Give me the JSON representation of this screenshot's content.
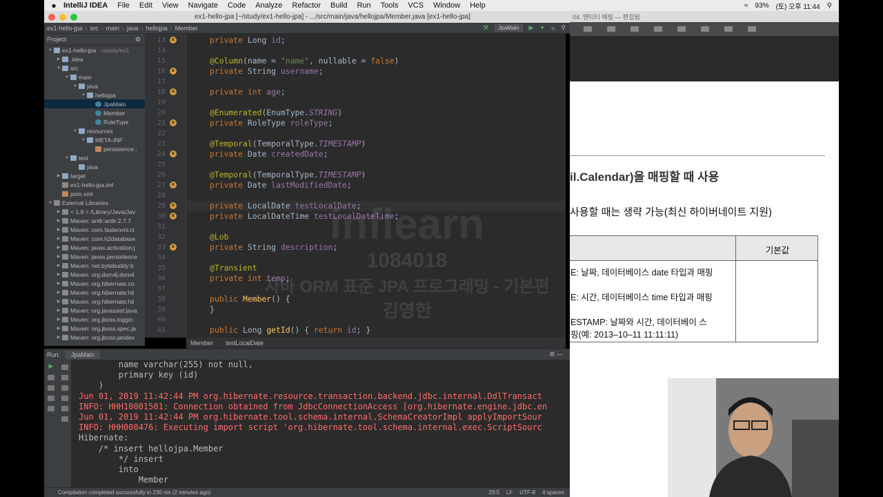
{
  "menubar": {
    "app_name": "IntelliJ IDEA",
    "items": [
      "File",
      "Edit",
      "View",
      "Navigate",
      "Code",
      "Analyze",
      "Refactor",
      "Build",
      "Run",
      "Tools",
      "VCS",
      "Window",
      "Help"
    ],
    "battery": "93%",
    "clock": "(토) 오후 11:44"
  },
  "window": {
    "title": "ex1-hello-jpa [~/study/ex1-hello-jpa] - .../src/main/java/hellojpa/Member.java [ex1-hello-jpa]"
  },
  "nav": {
    "crumbs": [
      "ex1-hello-jpa",
      "src",
      "main",
      "java",
      "hellojpa",
      "Member"
    ],
    "run_config": "JpaMain"
  },
  "project": {
    "header": "Project",
    "tree": [
      {
        "label": "ex1-hello-jpa",
        "hint": "~/study/ex1",
        "indent": 0,
        "icon": "folder",
        "open": true
      },
      {
        "label": ".idea",
        "indent": 1,
        "icon": "folder",
        "open": false
      },
      {
        "label": "src",
        "indent": 1,
        "icon": "folder",
        "open": true
      },
      {
        "label": "main",
        "indent": 2,
        "icon": "folder",
        "open": true
      },
      {
        "label": "java",
        "indent": 3,
        "icon": "folder",
        "open": true
      },
      {
        "label": "hellojpa",
        "indent": 4,
        "icon": "folder",
        "open": true
      },
      {
        "label": "JpaMain",
        "indent": 5,
        "icon": "java",
        "selected": true
      },
      {
        "label": "Member",
        "indent": 5,
        "icon": "java"
      },
      {
        "label": "RoleType",
        "indent": 5,
        "icon": "java"
      },
      {
        "label": "resources",
        "indent": 3,
        "icon": "folder",
        "open": true
      },
      {
        "label": "META-INF",
        "indent": 4,
        "icon": "folder",
        "open": true
      },
      {
        "label": "persistence.:",
        "indent": 5,
        "icon": "xml"
      },
      {
        "label": "test",
        "indent": 2,
        "icon": "folder",
        "open": true
      },
      {
        "label": "java",
        "indent": 3,
        "icon": "folder"
      },
      {
        "label": "target",
        "indent": 1,
        "icon": "folder",
        "open": false
      },
      {
        "label": "ex1-hello-jpa.iml",
        "indent": 1,
        "icon": "file"
      },
      {
        "label": "pom.xml",
        "indent": 1,
        "icon": "xml"
      },
      {
        "label": "External Libraries",
        "indent": 0,
        "icon": "lib",
        "open": true
      },
      {
        "label": "< 1.8 > /Library/Java/Jav",
        "indent": 1,
        "icon": "lib",
        "open": false
      },
      {
        "label": "Maven: antlr:antlr:2.7.7",
        "indent": 1,
        "icon": "lib",
        "open": false
      },
      {
        "label": "Maven: com.fasterxml.cl",
        "indent": 1,
        "icon": "lib",
        "open": false
      },
      {
        "label": "Maven: com.h2database",
        "indent": 1,
        "icon": "lib",
        "open": false
      },
      {
        "label": "Maven: javax.activation:j",
        "indent": 1,
        "icon": "lib",
        "open": false
      },
      {
        "label": "Maven: javax.persistence",
        "indent": 1,
        "icon": "lib",
        "open": false
      },
      {
        "label": "Maven: net.bytebuddy:b",
        "indent": 1,
        "icon": "lib",
        "open": false
      },
      {
        "label": "Maven: org.dom4j:dom4",
        "indent": 1,
        "icon": "lib",
        "open": false
      },
      {
        "label": "Maven: org.hibernate.co",
        "indent": 1,
        "icon": "lib",
        "open": false
      },
      {
        "label": "Maven: org.hibernate:hil",
        "indent": 1,
        "icon": "lib",
        "open": false
      },
      {
        "label": "Maven: org.hibernate:hil",
        "indent": 1,
        "icon": "lib",
        "open": false
      },
      {
        "label": "Maven: org.javassist:java",
        "indent": 1,
        "icon": "lib",
        "open": false
      },
      {
        "label": "Maven: org.jboss.loggin",
        "indent": 1,
        "icon": "lib",
        "open": false
      },
      {
        "label": "Maven: org.jboss.spec.ja",
        "indent": 1,
        "icon": "lib",
        "open": false
      },
      {
        "label": "Maven: org.jboss:jandex",
        "indent": 1,
        "icon": "lib",
        "open": false
      }
    ]
  },
  "editor": {
    "lines": [
      {
        "n": "13",
        "icon": true,
        "tokens": [
          [
            "kw",
            "private "
          ],
          [
            "",
            "Long "
          ],
          [
            "fld",
            "id"
          ],
          [
            "",
            ";"
          ]
        ]
      },
      {
        "n": "14",
        "tokens": []
      },
      {
        "n": "15",
        "tokens": [
          [
            "an",
            "@Column"
          ],
          [
            "",
            "(name = "
          ],
          [
            "str",
            "\"name\""
          ],
          [
            "",
            ", nullable = "
          ],
          [
            "kw",
            "false"
          ],
          [
            "",
            ")"
          ]
        ]
      },
      {
        "n": "16",
        "icon": true,
        "tokens": [
          [
            "kw",
            "private "
          ],
          [
            "",
            "String "
          ],
          [
            "fld",
            "username"
          ],
          [
            "",
            ";"
          ]
        ]
      },
      {
        "n": "17",
        "tokens": []
      },
      {
        "n": "18",
        "icon": true,
        "tokens": [
          [
            "kw",
            "private int "
          ],
          [
            "fld",
            "age"
          ],
          [
            "",
            ";"
          ]
        ]
      },
      {
        "n": "19",
        "tokens": []
      },
      {
        "n": "20",
        "tokens": [
          [
            "an",
            "@Enumerated"
          ],
          [
            "",
            "(EnumType."
          ],
          [
            "en",
            "STRING"
          ],
          [
            "",
            ")"
          ]
        ]
      },
      {
        "n": "21",
        "icon": true,
        "tokens": [
          [
            "kw",
            "private "
          ],
          [
            "",
            "RoleType "
          ],
          [
            "fld",
            "roleType"
          ],
          [
            "",
            ";"
          ]
        ]
      },
      {
        "n": "22",
        "tokens": []
      },
      {
        "n": "23",
        "tokens": [
          [
            "an",
            "@Temporal"
          ],
          [
            "",
            "(TemporalType."
          ],
          [
            "en",
            "TIMESTAMP"
          ],
          [
            "",
            ")"
          ]
        ]
      },
      {
        "n": "24",
        "icon": true,
        "tokens": [
          [
            "kw",
            "private "
          ],
          [
            "",
            "Date "
          ],
          [
            "fld",
            "createdDate"
          ],
          [
            "",
            ";"
          ]
        ]
      },
      {
        "n": "25",
        "tokens": []
      },
      {
        "n": "26",
        "tokens": [
          [
            "an",
            "@Temporal"
          ],
          [
            "",
            "(TemporalType."
          ],
          [
            "en",
            "TIMESTAMP"
          ],
          [
            "",
            ")"
          ]
        ]
      },
      {
        "n": "27",
        "icon": true,
        "tokens": [
          [
            "kw",
            "private "
          ],
          [
            "",
            "Date "
          ],
          [
            "fld",
            "lastModifiedDate"
          ],
          [
            "",
            ";"
          ]
        ]
      },
      {
        "n": "28",
        "tokens": []
      },
      {
        "n": "29",
        "icon": true,
        "current": true,
        "tokens": [
          [
            "kw",
            "private "
          ],
          [
            "",
            "LocalDate "
          ],
          [
            "fld",
            "testLocalDate"
          ],
          [
            "",
            ";"
          ]
        ]
      },
      {
        "n": "30",
        "icon": true,
        "tokens": [
          [
            "kw",
            "private "
          ],
          [
            "",
            "LocalDateTime "
          ],
          [
            "fld",
            "testLocalDateTime"
          ],
          [
            "",
            ";"
          ]
        ]
      },
      {
        "n": "31",
        "tokens": []
      },
      {
        "n": "32",
        "tokens": [
          [
            "an",
            "@Lob"
          ]
        ]
      },
      {
        "n": "33",
        "icon": true,
        "tokens": [
          [
            "kw",
            "private "
          ],
          [
            "",
            "String "
          ],
          [
            "fld",
            "description"
          ],
          [
            "",
            ";"
          ]
        ]
      },
      {
        "n": "34",
        "tokens": []
      },
      {
        "n": "35",
        "tokens": [
          [
            "an",
            "@Transient"
          ]
        ]
      },
      {
        "n": "36",
        "tokens": [
          [
            "kw",
            "private int "
          ],
          [
            "fld",
            "temp"
          ],
          [
            "",
            ";"
          ]
        ]
      },
      {
        "n": "37",
        "tokens": []
      },
      {
        "n": "38",
        "tokens": [
          [
            "kw",
            "public "
          ],
          [
            "mth",
            "Member"
          ],
          [
            "",
            "() {"
          ]
        ]
      },
      {
        "n": "39",
        "tokens": [
          [
            "",
            "}"
          ]
        ]
      },
      {
        "n": "40",
        "tokens": []
      },
      {
        "n": "41",
        "tokens": [
          [
            "kw",
            "public "
          ],
          [
            "",
            "Long "
          ],
          [
            "mth",
            "getId"
          ],
          [
            "",
            "() { "
          ],
          [
            "kw",
            "return "
          ],
          [
            "fld",
            "id"
          ],
          [
            "",
            "; }"
          ]
        ]
      }
    ],
    "breadcrumb": [
      "Member",
      "testLocalDate"
    ]
  },
  "run": {
    "label": "Run:",
    "tab": "JpaMain",
    "console": [
      {
        "t": "        name varchar(255) not null,",
        "red": false
      },
      {
        "t": "        primary key (id)",
        "red": false
      },
      {
        "t": "    )",
        "red": false
      },
      {
        "t": "Jun 01, 2019 11:42:44 PM org.hibernate.resource.transaction.backend.jdbc.internal.DdlTransact",
        "red": true
      },
      {
        "t": "INFO: HHH10001501: Connection obtained from JdbcConnectionAccess [org.hibernate.engine.jdbc.en",
        "red": true
      },
      {
        "t": "Jun 01, 2019 11:42:44 PM org.hibernate.tool.schema.internal.SchemaCreatorImpl applyImportSour",
        "red": true
      },
      {
        "t": "INFO: HHH000476: Executing import script 'org.hibernate.tool.schema.internal.exec.ScriptSourc",
        "red": true
      },
      {
        "t": "Hibernate:",
        "red": false
      },
      {
        "t": "    /* insert hellojpa.Member",
        "red": false
      },
      {
        "t": "        */ insert",
        "red": false
      },
      {
        "t": "        into",
        "red": false
      },
      {
        "t": "            Member",
        "red": false
      }
    ]
  },
  "status": {
    "message": "Compilation completed successfully in 230 ms (2 minutes ago)",
    "position": "29:5",
    "line_sep": "LF",
    "encoding": "UTF-8",
    "indent": "4 spaces"
  },
  "keynote": {
    "title": "04. 엔티티 매핑 — 편집됨"
  },
  "slide": {
    "line1": "il.Calendar)을 매핑할 때 사용",
    "line2": "사용할 때는 생략 가능(최신 하이버네이트 지원)",
    "table_header": "기본값",
    "rows": [
      "E: 날짜, 데이터베이스 date 타입과 매핑",
      "E: 시간, 데이터베이스 time 타입과 매핑",
      "ESTAMP: 날짜와 시간, 데이터베이 스",
      "핑(예: 2013–10–11 11:11:11)"
    ]
  },
  "watermark": {
    "brand": "inflearn",
    "id": "1084018",
    "course": "자바 ORM 표준 JPA 프로그래밍 - 기본편",
    "author": "김영한"
  }
}
